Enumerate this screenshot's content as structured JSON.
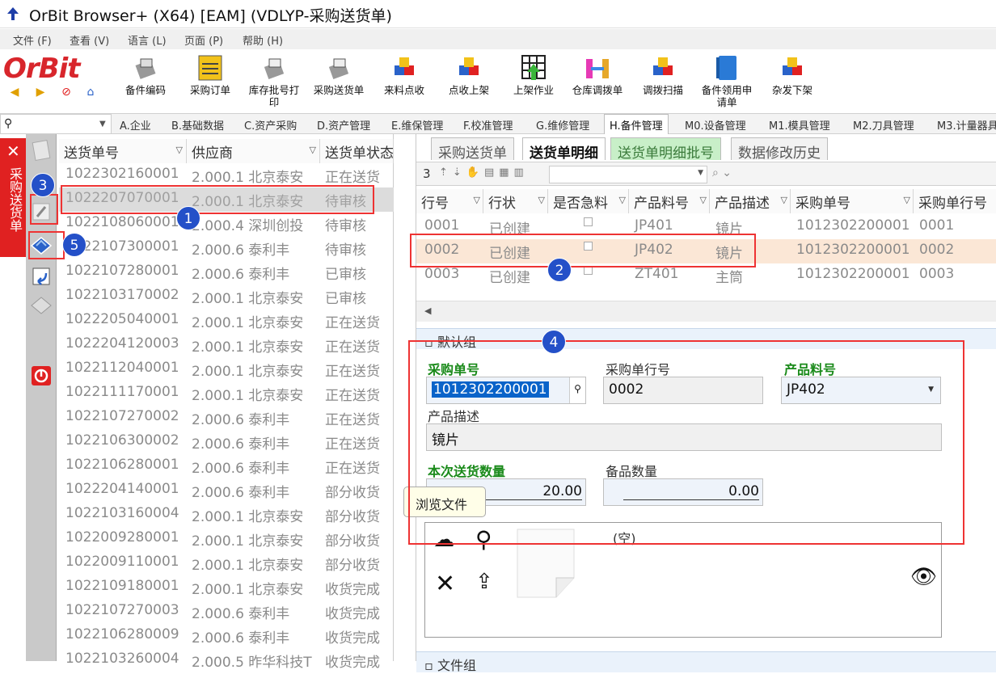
{
  "window": {
    "title": "OrBit Browser+ (X64) [EAM] (VDLYP-采购送货单)"
  },
  "menu": [
    "文件 (F)",
    "查看 (V)",
    "语言 (L)",
    "页面 (P)",
    "帮助 (H)"
  ],
  "logo": "OrBit",
  "toolbar": [
    {
      "label": "备件编码",
      "icon": "parts-code-icon"
    },
    {
      "label": "采购订单",
      "icon": "purchase-order-icon"
    },
    {
      "label": "库存批号打印",
      "icon": "print-icon"
    },
    {
      "label": "采购送货单",
      "icon": "delivery-note-icon"
    },
    {
      "label": "来料点收",
      "icon": "receive-icon"
    },
    {
      "label": "点收上架",
      "icon": "shelve-icon"
    },
    {
      "label": "上架作业",
      "icon": "grid-up-icon"
    },
    {
      "label": "仓库调拨单",
      "icon": "transfer-icon"
    },
    {
      "label": "调拨扫描",
      "icon": "scan-icon"
    },
    {
      "label": "备件领用申请单",
      "icon": "book-icon"
    },
    {
      "label": "杂发下架",
      "icon": "misc-issue-icon"
    }
  ],
  "module_tabs": [
    "A.企业",
    "B.基础数据",
    "C.资产采购",
    "D.资产管理",
    "E.维保管理",
    "F.校准管理",
    "G.维修管理",
    "H.备件管理",
    "M0.设备管理",
    "M1.模具管理",
    "M2.刀具管理",
    "M3.计量器具"
  ],
  "active_module": "H.备件管理",
  "vertical_tab": "采购送货单",
  "left_grid": {
    "headers": [
      "送货单号",
      "供应商",
      "送货单状态"
    ],
    "rows": [
      [
        "1022302160001",
        "2.000.1 北京泰安",
        "正在送货"
      ],
      [
        "1022207070001",
        "2.000.1 北京泰安",
        "待审核"
      ],
      [
        "1022108060001",
        "2.000.4 深圳创投",
        "待审核"
      ],
      [
        "1022107300001",
        "2.000.6 泰利丰",
        "待审核"
      ],
      [
        "1022107280001",
        "2.000.6 泰利丰",
        "已审核"
      ],
      [
        "1022103170002",
        "2.000.1 北京泰安",
        "已审核"
      ],
      [
        "1022205040001",
        "2.000.1 北京泰安",
        "正在送货"
      ],
      [
        "1022204120003",
        "2.000.1 北京泰安",
        "正在送货"
      ],
      [
        "1022112040001",
        "2.000.1 北京泰安",
        "正在送货"
      ],
      [
        "1022111170001",
        "2.000.1 北京泰安",
        "正在送货"
      ],
      [
        "1022107270002",
        "2.000.6 泰利丰",
        "正在送货"
      ],
      [
        "1022106300002",
        "2.000.6 泰利丰",
        "正在送货"
      ],
      [
        "1022106280001",
        "2.000.6 泰利丰",
        "正在送货"
      ],
      [
        "1022204140001",
        "2.000.6 泰利丰",
        "部分收货"
      ],
      [
        "1022103160004",
        "2.000.1 北京泰安",
        "部分收货"
      ],
      [
        "1022009280001",
        "2.000.1 北京泰安",
        "部分收货"
      ],
      [
        "1022009110001",
        "2.000.1 北京泰安",
        "部分收货"
      ],
      [
        "1022109180001",
        "2.000.1 北京泰安",
        "收货完成"
      ],
      [
        "1022107270003",
        "2.000.6 泰利丰",
        "收货完成"
      ],
      [
        "1022106280009",
        "2.000.6 泰利丰",
        "收货完成"
      ],
      [
        "1022103260004",
        "2.000.5 昨华科技T",
        "收货完成"
      ]
    ]
  },
  "sub_tabs": [
    "采购送货单",
    "送货单明细",
    "送货单明细批号",
    "数据修改历史"
  ],
  "detail_toolbar": {
    "count": "3"
  },
  "detail_grid": {
    "headers": [
      "行号",
      "行状",
      "是否急料",
      "产品料号",
      "产品描述",
      "采购单号",
      "采购单行号"
    ],
    "rows": [
      [
        "0001",
        "已创建",
        false,
        "JP401",
        "镜片",
        "1012302200001",
        "0001"
      ],
      [
        "0002",
        "已创建",
        false,
        "JP402",
        "镜片",
        "1012302200001",
        "0002"
      ],
      [
        "0003",
        "已创建",
        false,
        "ZT401",
        "主筒",
        "1012302200001",
        "0003"
      ]
    ]
  },
  "form": {
    "group_title": "默认组",
    "po_number_label": "采购单号",
    "po_number_value": "1012302200001",
    "po_line_label": "采购单行号",
    "po_line_value": "0002",
    "part_no_label": "产品料号",
    "part_no_value": "JP402",
    "desc_label": "产品描述",
    "desc_value": "镜片",
    "qty_label": "本次送货数量",
    "qty_value": "20.00",
    "spare_qty_label": "备品数量",
    "spare_qty_value": "0.00",
    "empty_text": "(空)",
    "next_group": "文件组"
  },
  "tooltip": "浏览文件",
  "annotations": [
    "1",
    "2",
    "3",
    "4",
    "5"
  ],
  "colors": {
    "accent_red": "#e33333",
    "badge_blue": "#2450c8",
    "required_green": "#1a8a1a"
  }
}
